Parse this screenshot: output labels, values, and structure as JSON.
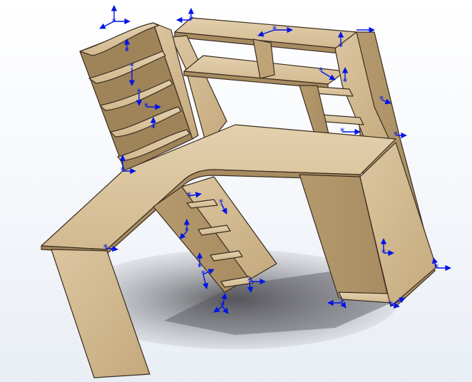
{
  "scene": {
    "subject": "corner computer desk with shelves",
    "material_color": "#cdb48a",
    "edge_color": "#3a2d20",
    "shadow_color": "#6f6f73",
    "annotation_color": "#0014e6"
  }
}
